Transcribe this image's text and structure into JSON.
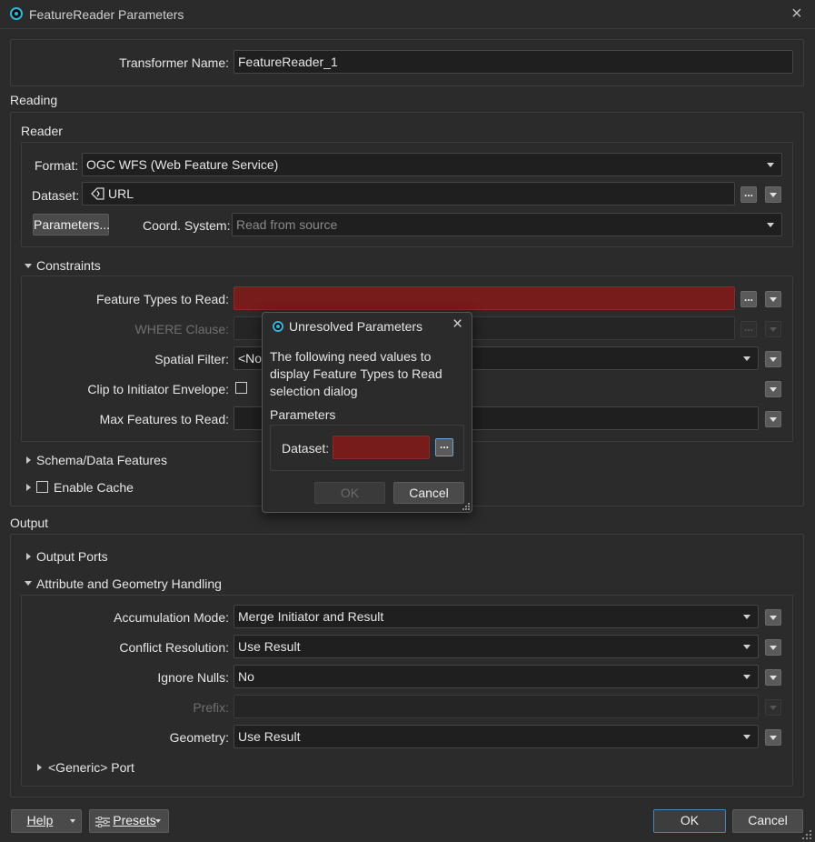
{
  "window": {
    "title": "FeatureReader Parameters",
    "close_icon": "×"
  },
  "transformer": {
    "label": "Transformer Name:",
    "value": "FeatureReader_1"
  },
  "reading": {
    "section": "Reading",
    "reader_group": "Reader",
    "format_label": "Format:",
    "format_value": "OGC WFS (Web Feature Service)",
    "dataset_label": "Dataset:",
    "dataset_value": "URL",
    "dataset_browse": "...",
    "parameters_button": "Parameters...",
    "coord_label": "Coord. System:",
    "coord_placeholder": "Read from source"
  },
  "constraints": {
    "header": "Constraints",
    "feature_types_label": "Feature Types to Read:",
    "feature_types_browse": "...",
    "where_label": "WHERE Clause:",
    "where_browse": "...",
    "spatial_label": "Spatial Filter:",
    "spatial_value": "<No",
    "clip_label": "Clip to Initiator Envelope:",
    "max_label": "Max Features to Read:"
  },
  "schema": {
    "label": "Schema/Data Features"
  },
  "cache": {
    "label": "Enable Cache"
  },
  "output": {
    "section": "Output",
    "output_ports": "Output Ports",
    "attr_geom": "Attribute and Geometry Handling",
    "accum_label": "Accumulation Mode:",
    "accum_value": "Merge Initiator and Result",
    "conflict_label": "Conflict Resolution:",
    "conflict_value": "Use Result",
    "ignore_label": "Ignore Nulls:",
    "ignore_value": "No",
    "prefix_label": "Prefix:",
    "geometry_label": "Geometry:",
    "geometry_value": "Use Result",
    "generic_port": "<Generic> Port"
  },
  "footer": {
    "help": "Help",
    "presets": "Presets",
    "ok": "OK",
    "cancel": "Cancel"
  },
  "modal": {
    "title": "Unresolved Parameters",
    "close_icon": "×",
    "message": "The following need values to display Feature Types to Read selection dialog",
    "params_header": "Parameters",
    "dataset_label": "Dataset:",
    "browse": "...",
    "ok": "OK",
    "cancel": "Cancel"
  }
}
